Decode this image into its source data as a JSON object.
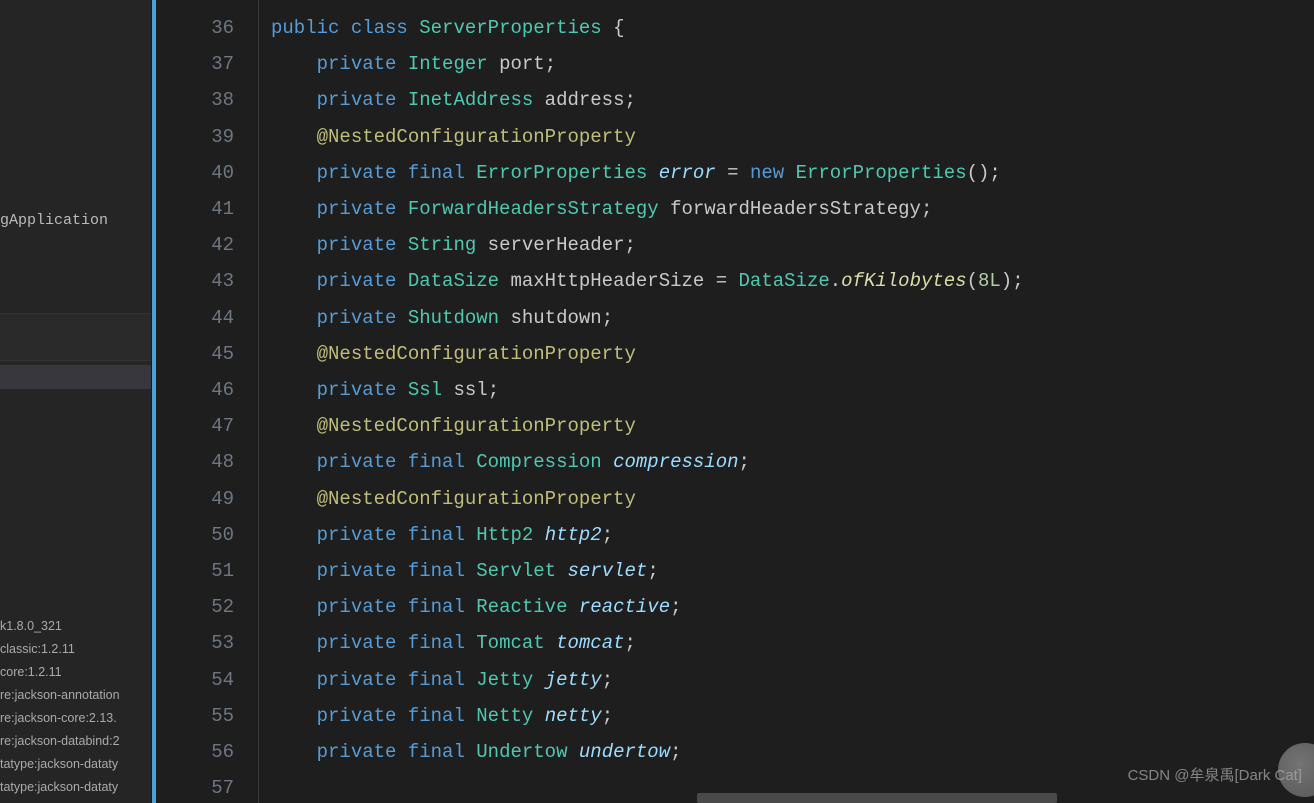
{
  "sidebar": {
    "file_entry": "gApplication",
    "libs": [
      "k1.8.0_321",
      "classic:1.2.11",
      "core:1.2.11",
      "re:jackson-annotation",
      "re:jackson-core:2.13.",
      "re:jackson-databind:2",
      "tatype:jackson-dataty",
      "tatype:jackson-dataty"
    ]
  },
  "gutter": {
    "start": 36,
    "end": 57
  },
  "code": {
    "lines": [
      {
        "n": 36,
        "tokens": [
          [
            "kw",
            "public"
          ],
          [
            "plain",
            " "
          ],
          [
            "kw",
            "class"
          ],
          [
            "plain",
            " "
          ],
          [
            "type",
            "ServerProperties"
          ],
          [
            "plain",
            " {"
          ]
        ]
      },
      {
        "n": 37,
        "indent": 1,
        "tokens": [
          [
            "kw",
            "private"
          ],
          [
            "plain",
            " "
          ],
          [
            "type",
            "Integer"
          ],
          [
            "plain",
            " "
          ],
          [
            "var-name",
            "port"
          ],
          [
            "plain",
            ";"
          ]
        ]
      },
      {
        "n": 38,
        "indent": 1,
        "tokens": [
          [
            "kw",
            "private"
          ],
          [
            "plain",
            " "
          ],
          [
            "type",
            "InetAddress"
          ],
          [
            "plain",
            " "
          ],
          [
            "var-name",
            "address"
          ],
          [
            "plain",
            ";"
          ]
        ]
      },
      {
        "n": 39,
        "indent": 1,
        "tokens": [
          [
            "anno",
            "@NestedConfigurationProperty"
          ]
        ]
      },
      {
        "n": 40,
        "indent": 1,
        "tokens": [
          [
            "kw",
            "private"
          ],
          [
            "plain",
            " "
          ],
          [
            "kw",
            "final"
          ],
          [
            "plain",
            " "
          ],
          [
            "type",
            "ErrorProperties"
          ],
          [
            "plain",
            " "
          ],
          [
            "italic-id",
            "error"
          ],
          [
            "plain",
            " = "
          ],
          [
            "kw",
            "new"
          ],
          [
            "plain",
            " "
          ],
          [
            "type",
            "ErrorProperties"
          ],
          [
            "plain",
            "();"
          ]
        ]
      },
      {
        "n": 41,
        "indent": 1,
        "tokens": [
          [
            "kw",
            "private"
          ],
          [
            "plain",
            " "
          ],
          [
            "type",
            "ForwardHeadersStrategy"
          ],
          [
            "plain",
            " "
          ],
          [
            "var-name",
            "forwardHeadersStrategy"
          ],
          [
            "plain",
            ";"
          ]
        ]
      },
      {
        "n": 42,
        "indent": 1,
        "tokens": [
          [
            "kw",
            "private"
          ],
          [
            "plain",
            " "
          ],
          [
            "type",
            "String"
          ],
          [
            "plain",
            " "
          ],
          [
            "var-name",
            "serverHeader"
          ],
          [
            "plain",
            ";"
          ]
        ]
      },
      {
        "n": 43,
        "indent": 1,
        "tokens": [
          [
            "kw",
            "private"
          ],
          [
            "plain",
            " "
          ],
          [
            "type",
            "DataSize"
          ],
          [
            "plain",
            " "
          ],
          [
            "var-name",
            "maxHttpHeaderSize"
          ],
          [
            "plain",
            " = "
          ],
          [
            "type",
            "DataSize"
          ],
          [
            "plain",
            "."
          ],
          [
            "method-i",
            "ofKilobytes"
          ],
          [
            "plain",
            "("
          ],
          [
            "num",
            "8L"
          ],
          [
            "plain",
            ");"
          ]
        ]
      },
      {
        "n": 44,
        "indent": 1,
        "tokens": [
          [
            "kw",
            "private"
          ],
          [
            "plain",
            " "
          ],
          [
            "type",
            "Shutdown"
          ],
          [
            "plain",
            " "
          ],
          [
            "var-name",
            "shutdown"
          ],
          [
            "plain",
            ";"
          ]
        ]
      },
      {
        "n": 45,
        "indent": 1,
        "tokens": [
          [
            "anno",
            "@NestedConfigurationProperty"
          ]
        ]
      },
      {
        "n": 46,
        "indent": 1,
        "tokens": [
          [
            "kw",
            "private"
          ],
          [
            "plain",
            " "
          ],
          [
            "type",
            "Ssl"
          ],
          [
            "plain",
            " "
          ],
          [
            "var-name",
            "ssl"
          ],
          [
            "plain",
            ";"
          ]
        ]
      },
      {
        "n": 47,
        "indent": 1,
        "tokens": [
          [
            "anno",
            "@NestedConfigurationProperty"
          ]
        ]
      },
      {
        "n": 48,
        "indent": 1,
        "tokens": [
          [
            "kw",
            "private"
          ],
          [
            "plain",
            " "
          ],
          [
            "kw",
            "final"
          ],
          [
            "plain",
            " "
          ],
          [
            "type",
            "Compression"
          ],
          [
            "plain",
            " "
          ],
          [
            "italic-id",
            "compression"
          ],
          [
            "plain",
            ";"
          ]
        ]
      },
      {
        "n": 49,
        "indent": 1,
        "tokens": [
          [
            "anno",
            "@NestedConfigurationProperty"
          ]
        ]
      },
      {
        "n": 50,
        "indent": 1,
        "tokens": [
          [
            "kw",
            "private"
          ],
          [
            "plain",
            " "
          ],
          [
            "kw",
            "final"
          ],
          [
            "plain",
            " "
          ],
          [
            "type",
            "Http2"
          ],
          [
            "plain",
            " "
          ],
          [
            "italic-id",
            "http2"
          ],
          [
            "plain",
            ";"
          ]
        ]
      },
      {
        "n": 51,
        "indent": 1,
        "tokens": [
          [
            "kw",
            "private"
          ],
          [
            "plain",
            " "
          ],
          [
            "kw",
            "final"
          ],
          [
            "plain",
            " "
          ],
          [
            "type",
            "Servlet"
          ],
          [
            "plain",
            " "
          ],
          [
            "italic-id",
            "servlet"
          ],
          [
            "plain",
            ";"
          ]
        ]
      },
      {
        "n": 52,
        "indent": 1,
        "tokens": [
          [
            "kw",
            "private"
          ],
          [
            "plain",
            " "
          ],
          [
            "kw",
            "final"
          ],
          [
            "plain",
            " "
          ],
          [
            "type",
            "Reactive"
          ],
          [
            "plain",
            " "
          ],
          [
            "italic-id",
            "reactive"
          ],
          [
            "plain",
            ";"
          ]
        ]
      },
      {
        "n": 53,
        "indent": 1,
        "tokens": [
          [
            "kw",
            "private"
          ],
          [
            "plain",
            " "
          ],
          [
            "kw",
            "final"
          ],
          [
            "plain",
            " "
          ],
          [
            "type",
            "Tomcat"
          ],
          [
            "plain",
            " "
          ],
          [
            "italic-id",
            "tomcat"
          ],
          [
            "plain",
            ";"
          ]
        ]
      },
      {
        "n": 54,
        "indent": 1,
        "tokens": [
          [
            "kw",
            "private"
          ],
          [
            "plain",
            " "
          ],
          [
            "kw",
            "final"
          ],
          [
            "plain",
            " "
          ],
          [
            "type",
            "Jetty"
          ],
          [
            "plain",
            " "
          ],
          [
            "italic-id",
            "jetty"
          ],
          [
            "plain",
            ";"
          ]
        ]
      },
      {
        "n": 55,
        "indent": 1,
        "tokens": [
          [
            "kw",
            "private"
          ],
          [
            "plain",
            " "
          ],
          [
            "kw",
            "final"
          ],
          [
            "plain",
            " "
          ],
          [
            "type",
            "Netty"
          ],
          [
            "plain",
            " "
          ],
          [
            "italic-id",
            "netty"
          ],
          [
            "plain",
            ";"
          ]
        ]
      },
      {
        "n": 56,
        "indent": 1,
        "tokens": [
          [
            "kw",
            "private"
          ],
          [
            "plain",
            " "
          ],
          [
            "kw",
            "final"
          ],
          [
            "plain",
            " "
          ],
          [
            "type",
            "Undertow"
          ],
          [
            "plain",
            " "
          ],
          [
            "italic-id",
            "undertow"
          ],
          [
            "plain",
            ";"
          ]
        ]
      },
      {
        "n": 57,
        "indent": 1,
        "tokens": []
      }
    ]
  },
  "annotation_color": "#dcdcaa",
  "watermark": "CSDN @牟泉禹[Dark Cat]"
}
